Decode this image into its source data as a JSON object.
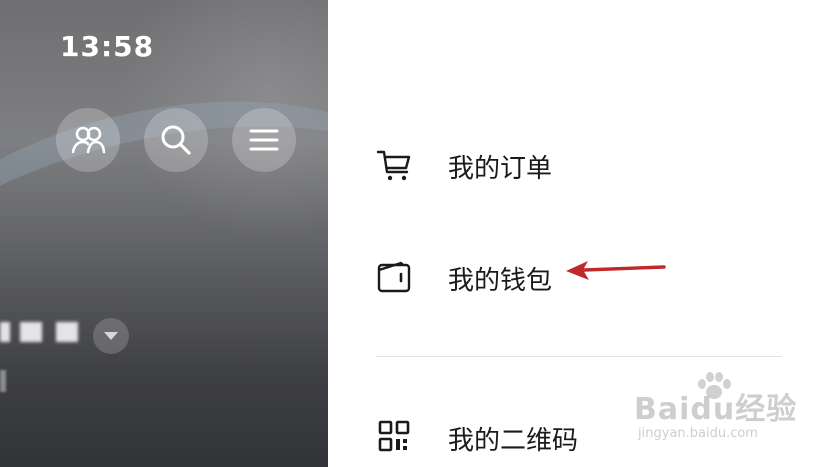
{
  "status_bar": {
    "time": "13:58"
  },
  "top_buttons": [
    {
      "icon": "friends-icon"
    },
    {
      "icon": "search-icon"
    },
    {
      "icon": "menu-icon"
    }
  ],
  "menu": {
    "items": [
      {
        "label": "我的订单",
        "icon": "cart-icon"
      },
      {
        "label": "我的钱包",
        "icon": "wallet-icon"
      },
      {
        "label": "我的二维码",
        "icon": "qr-code-icon"
      }
    ]
  },
  "annotation": {
    "arrow_color": "#c0282a"
  },
  "watermark": {
    "main": "Baidu经验",
    "sub": "jingyan.baidu.com"
  }
}
